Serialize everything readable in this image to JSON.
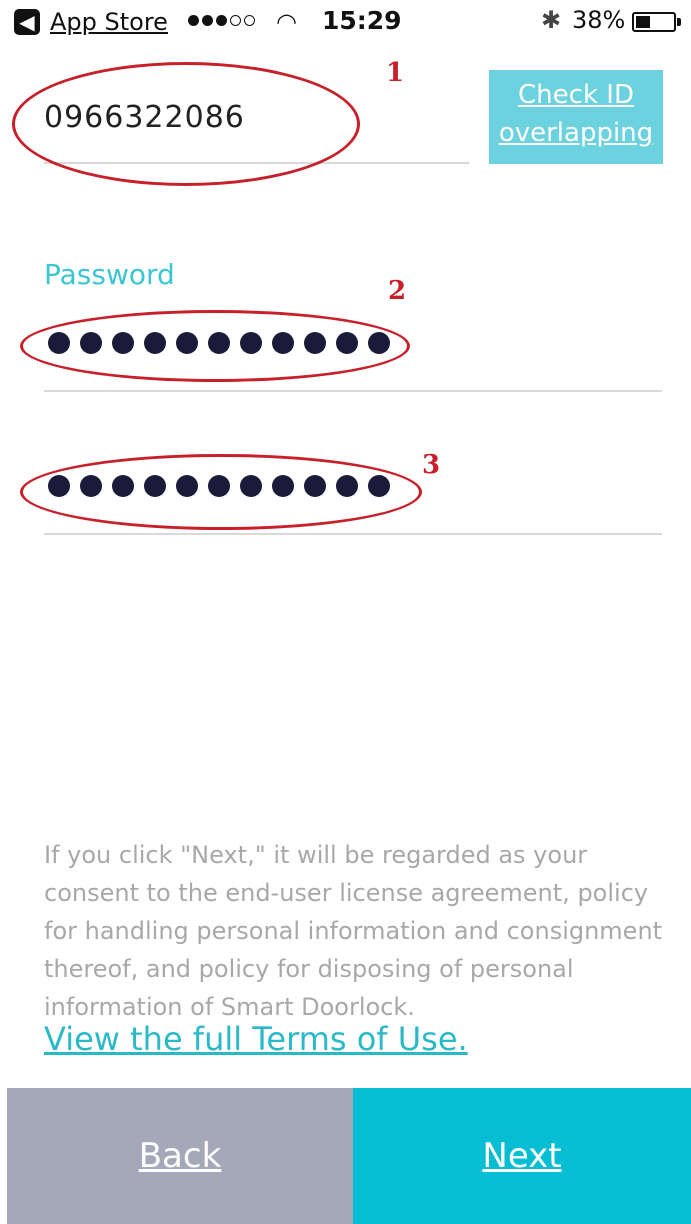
{
  "status_bar": {
    "back_app_label": "App Store",
    "back_glyph": "◀",
    "time": "15:29",
    "battery_percent": "38%",
    "battery_level": 0.38,
    "signal_bars_filled": 3,
    "signal_bars_total": 5,
    "icons": [
      "back-arrow-icon",
      "signal-icon",
      "wifi-icon",
      "bluetooth-icon",
      "battery-icon"
    ]
  },
  "form": {
    "id_value": "0966322086",
    "check_id_label_line1": "Check ID",
    "check_id_label_line2": "overlapping",
    "password_label": "Password",
    "password_mask_count": 11,
    "confirm_mask_count": 11
  },
  "annotations": {
    "numbers": [
      "1",
      "2",
      "3"
    ],
    "color": "#c8202a"
  },
  "consent": {
    "text": "If you click \"Next,\" it will be regarded as your consent to the end-user license agreement, policy for handling personal information and consignment thereof, and policy for disposing of personal information of Smart Doorlock.",
    "terms_link": "View the full Terms of Use."
  },
  "buttons": {
    "back_label": "Back",
    "next_label": "Next"
  },
  "colors": {
    "accent": "#05bed3",
    "label_teal": "#3bc6d3",
    "back_button": "#a4a8b8",
    "check_button": "#6dd2e0"
  }
}
